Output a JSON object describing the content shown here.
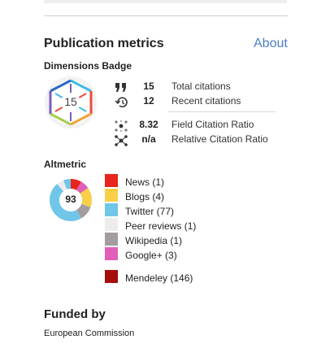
{
  "section": {
    "title": "Publication metrics",
    "about_label": "About"
  },
  "dimensions": {
    "heading": "Dimensions Badge",
    "badge_value": "15",
    "metrics": [
      {
        "icon": "quote-icon",
        "value": "15",
        "label": "Total citations"
      },
      {
        "icon": "history-icon",
        "value": "12",
        "label": "Recent citations"
      },
      {
        "icon": "scatter-dots-icon",
        "value": "8.32",
        "label": "Field Citation Ratio"
      },
      {
        "icon": "network-dots-icon",
        "value": "n/a",
        "label": "Relative Citation Ratio"
      }
    ]
  },
  "altmetric": {
    "heading": "Altmetric",
    "score": "93",
    "sources": [
      {
        "label": "News (1)",
        "color": "#e8251e"
      },
      {
        "label": "Blogs (4)",
        "color": "#f9cf4a"
      },
      {
        "label": "Twitter (77)",
        "color": "#6fc6e8"
      },
      {
        "label": "Peer reviews (1)",
        "color": "#ececec"
      },
      {
        "label": "Wikipedia (1)",
        "color": "#a39da0"
      },
      {
        "label": "Google+ (3)",
        "color": "#e15fb8"
      },
      {
        "label": "Mendeley (146)",
        "color": "#a50d0a"
      }
    ]
  },
  "funding": {
    "heading": "Funded by",
    "funder": "European Commission"
  }
}
